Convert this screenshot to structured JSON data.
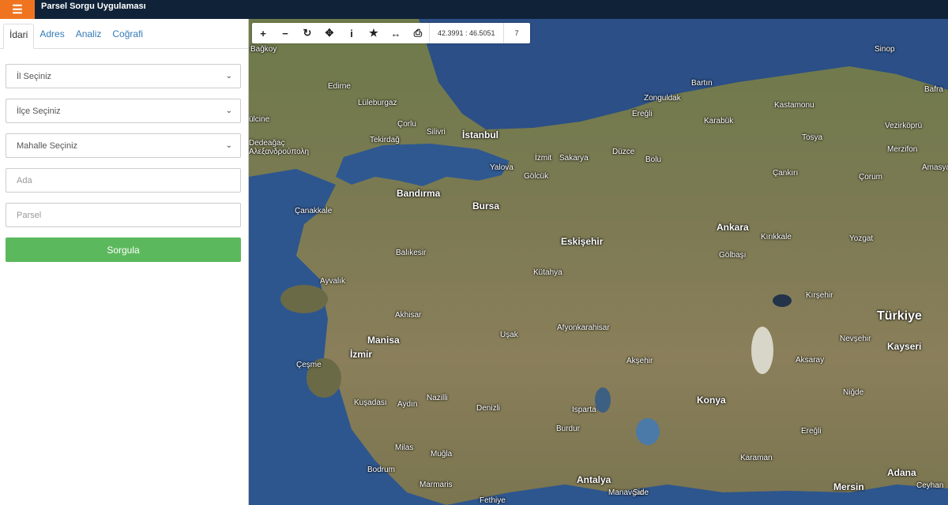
{
  "header": {
    "menu_icon": "hamburger-icon",
    "title": "Parsel Sorgu Uygulaması",
    "accent": "#f0741f",
    "bg": "#0f2238"
  },
  "sidebar": {
    "tabs": [
      {
        "label": "İdari",
        "active": true
      },
      {
        "label": "Adres"
      },
      {
        "label": "Analiz"
      },
      {
        "label": "Coğrafi"
      }
    ],
    "il_select": "İl Seçiniz",
    "ilce_select": "İlçe Seçiniz",
    "mahalle_select": "Mahalle Seçiniz",
    "ada_placeholder": "Ada",
    "parsel_placeholder": "Parsel",
    "submit_label": "Sorgula",
    "submit_color": "#5cb85c"
  },
  "toolbar": {
    "tools": [
      "zoom-in-icon",
      "zoom-out-icon",
      "refresh-icon",
      "pan-icon",
      "info-icon",
      "star-icon",
      "measure-icon",
      "print-icon"
    ],
    "coordinates": "42.3991 : 46.5051",
    "zoom_level": "7"
  },
  "map_labels": {
    "askoy": "Bağkoy",
    "edirne": "Edirne",
    "luleburgaz": "Lüleburgaz",
    "corlu": "Çorlu",
    "silivri": "Silivri",
    "istanbul": "İstanbul",
    "tekirdag": "Tekirdağ",
    "dedeagac": "Dedeağaç\nΑλεξανδρούπολη",
    "gumulcine": "ülcine",
    "yalova": "Yalova",
    "izmit": "İzmit",
    "sakarya": "Sakarya",
    "golcuk": "Gölcük",
    "duzce": "Düzce",
    "bolu": "Bolu",
    "eregli": "Ereğli",
    "zonguldak": "Zonguldak",
    "bartin": "Bartın",
    "karabuk": "Karabük",
    "kastamonu": "Kastamonu",
    "sinop": "Sinop",
    "bafra": "Bafra",
    "tosya": "Tosya",
    "vezirkopru": "Vezirköprü",
    "merzifon": "Merzifon",
    "amasya": "Amasya",
    "cankiri": "Çankırı",
    "corum": "Çorum",
    "bandirma": "Bandırma",
    "bursa": "Bursa",
    "canakkale": "Çanakkale",
    "ankara": "Ankara",
    "kirikkale": "Kırıkkale",
    "golbasi": "Gölbaşı",
    "yozgat": "Yozgat",
    "eskisehir": "Eskişehir",
    "balikesir": "Balıkesir",
    "kutahya": "Kütahya",
    "ayvalik": "Ayvalık",
    "akhisar": "Akhisar",
    "manisa": "Manisa",
    "izmir": "İzmir",
    "usak": "Uşak",
    "afyon": "Afyonkarahisar",
    "kirsehir": "Kırşehir",
    "turkiye": "Türkiye",
    "nevsehir": "Nevşehir",
    "kayseri": "Kayseri",
    "aksaray": "Aksaray",
    "aksehir": "Akşehir",
    "cesme": "Çeşme",
    "kusadasi": "Kuşadası",
    "aydin": "Aydın",
    "nazilli": "Nazilli",
    "denizli": "Denizli",
    "isparta": "Isparta",
    "burdur": "Burdur",
    "konya": "Konya",
    "nigde": "Niğde",
    "eregli2": "Ereğli",
    "milas": "Milas",
    "mugla": "Muğla",
    "bodrum": "Bodrum",
    "marmaris": "Marmaris",
    "fethiye": "Fethiye",
    "antalya": "Antalya",
    "manavgat": "Manavgat",
    "side": "Side",
    "karaman": "Karaman",
    "mersin": "Mersin",
    "adana": "Adana",
    "ceyhan": "Ceyhan"
  }
}
